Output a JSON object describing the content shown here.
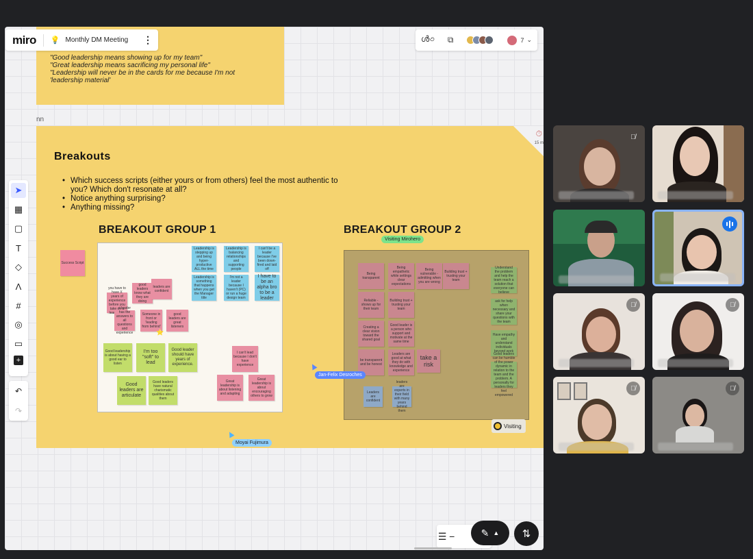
{
  "header": {
    "logo": "miro",
    "board_name": "Monthly DM Meeting"
  },
  "collab": {
    "participant_count": "7"
  },
  "top_frame": {
    "quotes": [
      "\"Good leadership means showing up for my team\"",
      "\"Great leadership means sacrificing my personal life\"",
      "\"Leadership will never be in the cards for me because I'm not",
      "'leadership material'"
    ],
    "tag": "nn"
  },
  "main_frame": {
    "title": "Breakouts",
    "timer_text": "15 m",
    "questions": [
      "Which success scripts (either yours or from others) feel the most authentic to you? Which don't resonate at all?",
      "Notice anything surprising?",
      "Anything missing?"
    ],
    "side_note": "Success Script"
  },
  "group1": {
    "title": "BREAKOUT GROUP 1",
    "notes": [
      {
        "text": "Leadership is stepping up and being hyper-productive ALL the time",
        "color": "blue"
      },
      {
        "text": "Leadership is balancing relationships and supporting people",
        "color": "blue"
      },
      {
        "text": "I can't be a leader because I've been down-fired and laid off",
        "color": "blue"
      },
      {
        "text": "Leadership is something that happens when you get the Manager title",
        "color": "blue"
      },
      {
        "text": "I'm not a leader because I haven't (PC) or run a huge design team",
        "color": "blue"
      },
      {
        "text": "I have to be an alpha bro to be a leader",
        "color": "blue"
      },
      {
        "text": "good leaders know what they are doing",
        "color": "pink"
      },
      {
        "text": "leaders are confident",
        "color": "pink"
      },
      {
        "text": "you have to have X years of experience before you take on a leadership role",
        "color": "pink"
      },
      {
        "text": "a leader has the answers to all questions and experience",
        "color": "pink"
      },
      {
        "text": "Someone in front or 'leading from behind'",
        "color": "pink"
      },
      {
        "text": "good leaders are great listeners",
        "color": "pink"
      },
      {
        "text": "Good leadership is about having a good ear to listen",
        "color": "green"
      },
      {
        "text": "I'm too \"soft\" to lead",
        "color": "green"
      },
      {
        "text": "Good leader should have years of experience.",
        "color": "green"
      },
      {
        "text": "Good leaders are articulate",
        "color": "green"
      },
      {
        "text": "Good leaders have natural charismatic qualities about them",
        "color": "green"
      },
      {
        "text": "I can't lead because I don't have experience",
        "color": "pink"
      },
      {
        "text": "Great leadership is about listening and adapting",
        "color": "pink"
      },
      {
        "text": "Great leadership is about encouraging others to grow",
        "color": "pink"
      }
    ]
  },
  "group2": {
    "title": "BREAKOUT GROUP 2",
    "notes": [
      {
        "text": "Being transparent",
        "color": "mauve"
      },
      {
        "text": "Being empathetic while settings clear expectations",
        "color": "mauve"
      },
      {
        "text": "Being vulnerable - admitting when you are wrong",
        "color": "mauve"
      },
      {
        "text": "Building trust + trusting your team",
        "color": "mauve"
      },
      {
        "text": "Reliable - shows up for their team",
        "color": "mauve"
      },
      {
        "text": "Building trust + trusting your team",
        "color": "mauve"
      },
      {
        "text": "Creating a clear vision toward the shared goal",
        "color": "mauve"
      },
      {
        "text": "Good leader is a person who support and motivate at the same time",
        "color": "mauve"
      },
      {
        "text": "be transparent and be honest",
        "color": "mauve"
      },
      {
        "text": "Leaders are good at what they do with knowledge and experience",
        "color": "mauve"
      },
      {
        "text": "take a risk",
        "color": "mauve"
      },
      {
        "text": "Leaders are confident",
        "color": "steel"
      },
      {
        "text": "leaders are experts in their field with many years behind them",
        "color": "steel"
      },
      {
        "text": "Understand the problem and help the team reach a solution that everyone can believe",
        "color": "dgreen"
      },
      {
        "text": "ask for help when necessary and share your questions with the team",
        "color": "dgreen"
      },
      {
        "text": "Have empathy and understand individuals beyond work",
        "color": "dgreen"
      },
      {
        "text": "Good leaders can be humble of the power dynamic in relation to the team and the problem. A personally for leaders they feel empowered",
        "color": "dgreen"
      }
    ]
  },
  "cursors": {
    "visiting_tag": "Visiting Mirohero",
    "jan_tag": "Jan-Felix Desroches",
    "moyai_tag": "Moyai Fujimura",
    "visiting_badge": "Visiting"
  },
  "colors": {
    "frame_yellow": "#f5d36f",
    "sticky_blue": "#7fcde8",
    "sticky_pink": "#e88fa2",
    "sticky_green": "#c2dd6a",
    "meet_bg": "#202124",
    "speaking_blue": "#1a73e8"
  },
  "video_tiles": [
    {
      "id": "p1",
      "muted": true
    },
    {
      "id": "p2",
      "muted": false
    },
    {
      "id": "p3",
      "muted": false
    },
    {
      "id": "p4",
      "speaking": true
    },
    {
      "id": "p5",
      "muted": true
    },
    {
      "id": "p6",
      "muted": true
    },
    {
      "id": "p7",
      "muted": true
    },
    {
      "id": "p8",
      "muted": true
    }
  ]
}
